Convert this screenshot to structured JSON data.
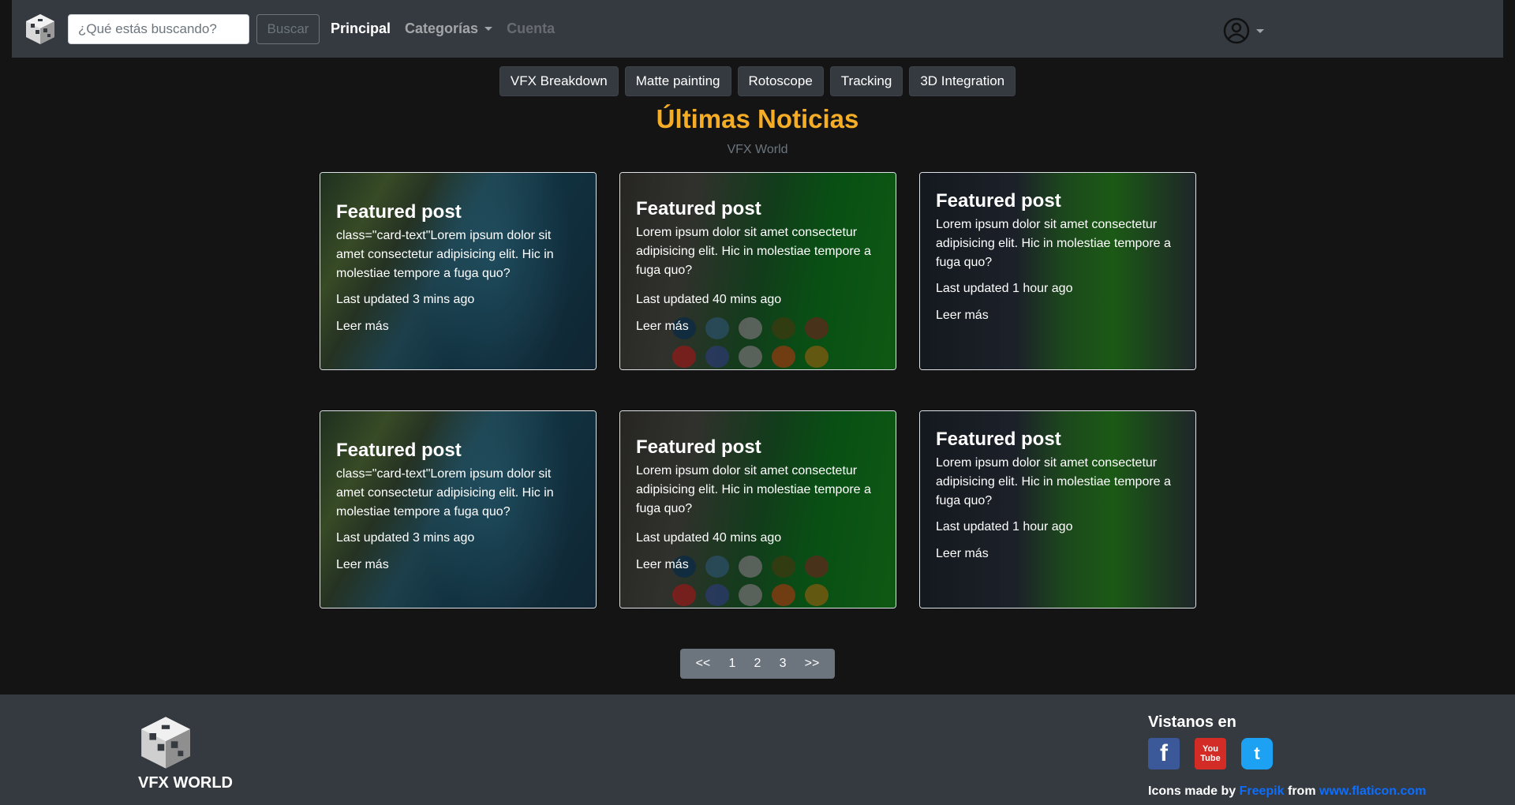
{
  "navbar": {
    "search_placeholder": "¿Qué estás buscando?",
    "search_button": "Buscar",
    "links": {
      "principal": "Principal",
      "categorias": "Categorías",
      "cuenta": "Cuenta"
    }
  },
  "categories": [
    "VFX Breakdown",
    "Matte painting",
    "Rotoscope",
    "Tracking",
    "3D Integration"
  ],
  "header": {
    "title": "Últimas Noticias",
    "subtitle": "VFX World"
  },
  "cards": [
    {
      "title": "Featured post",
      "text": "class=\"card-text\"Lorem ipsum dolor sit amet consectetur adipisicing elit. Hic in molestiae tempore a fuga quo?",
      "meta": "Last updated 3 mins ago",
      "link": "Leer más"
    },
    {
      "title": "Featured post",
      "text": "Lorem ipsum dolor sit amet consectetur adipisicing elit. Hic in molestiae tempore a fuga quo?",
      "meta": "Last updated 40 mins ago",
      "link": "Leer más"
    },
    {
      "title": "Featured post",
      "text": "Lorem ipsum dolor sit amet consectetur adipisicing elit. Hic in molestiae tempore a fuga quo?",
      "meta": "Last updated 1 hour ago",
      "link": "Leer más"
    },
    {
      "title": "Featured post",
      "text": "class=\"card-text\"Lorem ipsum dolor sit amet consectetur adipisicing elit. Hic in molestiae tempore a fuga quo?",
      "meta": "Last updated 3 mins ago",
      "link": "Leer más"
    },
    {
      "title": "Featured post",
      "text": "Lorem ipsum dolor sit amet consectetur adipisicing elit. Hic in molestiae tempore a fuga quo?",
      "meta": "Last updated 40 mins ago",
      "link": "Leer más"
    },
    {
      "title": "Featured post",
      "text": "Lorem ipsum dolor sit amet consectetur adipisicing elit. Hic in molestiae tempore a fuga quo?",
      "meta": "Last updated 1 hour ago",
      "link": "Leer más"
    }
  ],
  "pagination": [
    "<<",
    "1",
    "2",
    "3",
    ">>"
  ],
  "footer": {
    "brand": "VFX WORLD",
    "visit_title": "Vistanos en",
    "social": {
      "facebook": "f",
      "youtube_top": "You",
      "youtube_bottom": "Tube",
      "twitter": "t"
    },
    "credits_prefix": "Icons made by",
    "credits_author": "Freepik",
    "credits_mid": "from",
    "credits_site": "www.flaticon.com"
  },
  "colors": {
    "accent": "#f6ad26",
    "navbar": "#343a40",
    "link": "#0d6efd"
  }
}
